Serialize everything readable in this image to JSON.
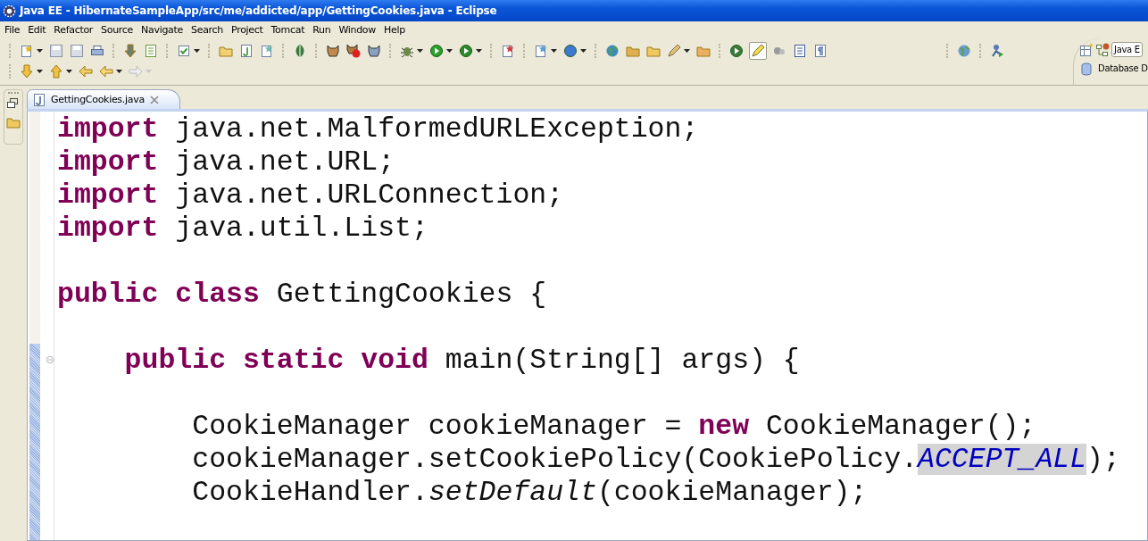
{
  "window": {
    "title": "Java EE - HibernateSampleApp/src/me/addicted/app/GettingCookies.java - Eclipse"
  },
  "menu": [
    "File",
    "Edit",
    "Refactor",
    "Source",
    "Navigate",
    "Search",
    "Project",
    "Tomcat",
    "Run",
    "Window",
    "Help"
  ],
  "perspectives": [
    {
      "label": "Java E",
      "selected": true
    },
    {
      "label": "Database D",
      "selected": false
    }
  ],
  "editor_tabs": [
    {
      "label": "GettingCookies.java",
      "selected": true
    }
  ],
  "code_lines": [
    {
      "tokens": [
        {
          "kind": "keyword",
          "text": "import"
        },
        {
          "kind": "plain",
          "text": " java.net.MalformedURLException;"
        }
      ]
    },
    {
      "tokens": [
        {
          "kind": "keyword",
          "text": "import"
        },
        {
          "kind": "plain",
          "text": " java.net.URL;"
        }
      ]
    },
    {
      "tokens": [
        {
          "kind": "keyword",
          "text": "import"
        },
        {
          "kind": "plain",
          "text": " java.net.URLConnection;"
        }
      ]
    },
    {
      "tokens": [
        {
          "kind": "keyword",
          "text": "import"
        },
        {
          "kind": "plain",
          "text": " java.util.List;"
        }
      ]
    },
    {
      "blank": true
    },
    {
      "tokens": [
        {
          "kind": "keyword",
          "text": "public class"
        },
        {
          "kind": "plain",
          "text": " GettingCookies {"
        }
      ]
    },
    {
      "blank": true
    },
    {
      "fold": {
        "expanded": true
      },
      "tokens": [
        {
          "kind": "keyword",
          "text": "    public static void"
        },
        {
          "kind": "plain",
          "text": " main(String[] args) {"
        }
      ]
    },
    {
      "blank": true
    },
    {
      "tokens": [
        {
          "kind": "plain",
          "text": "        CookieManager cookieManager = "
        },
        {
          "kind": "keyword",
          "text": "new"
        },
        {
          "kind": "plain",
          "text": " CookieManager();"
        }
      ]
    },
    {
      "tokens": [
        {
          "kind": "plain",
          "text": "        cookieManager.setCookiePolicy(CookiePolicy."
        },
        {
          "kind": "static-field",
          "text": "ACCEPT_ALL",
          "highlighted": true
        },
        {
          "kind": "plain",
          "text": ");"
        }
      ]
    },
    {
      "tokens": [
        {
          "kind": "plain",
          "text": "        CookieHandler."
        },
        {
          "kind": "static-method",
          "text": "setDefault"
        },
        {
          "kind": "plain",
          "text": "(cookieManager);"
        }
      ]
    }
  ]
}
